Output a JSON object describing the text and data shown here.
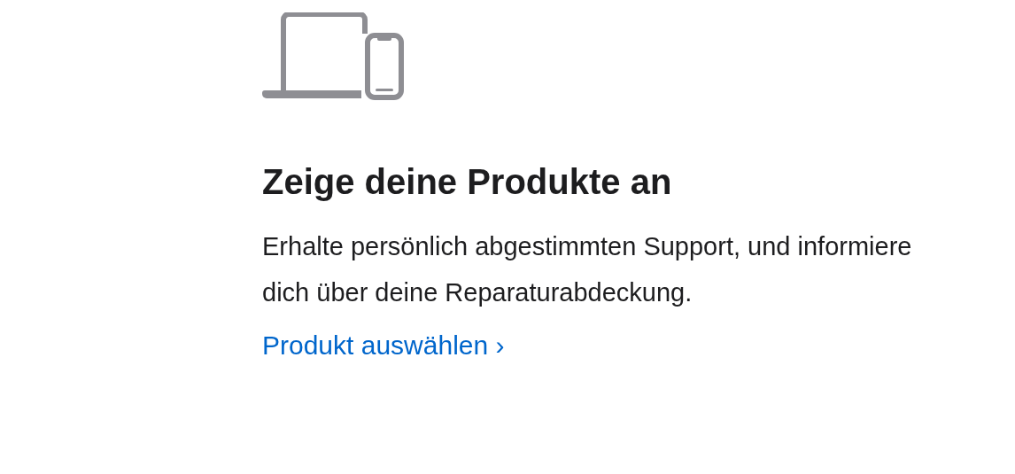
{
  "promo": {
    "heading": "Zeige deine Produkte an",
    "description": "Erhalte persönlich abgestimmten Support, und informiere dich über deine Reparaturabdeckung.",
    "link": "Produkt auswählen ›"
  }
}
